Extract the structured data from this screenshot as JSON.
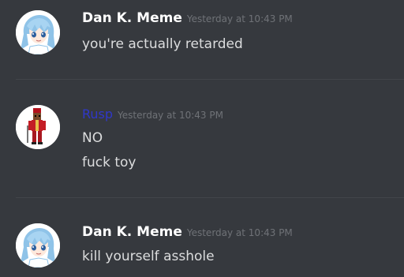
{
  "messages": [
    {
      "author": "Dan K. Meme",
      "timestamp": "Yesterday at 10:43 PM",
      "avatar": "anime-girl-avatar",
      "lines": [
        "you're actually retarded"
      ]
    },
    {
      "author": "Rusp",
      "timestamp": "Yesterday at 10:43 PM",
      "avatar": "red-uniform-character-avatar",
      "author_color": "#2f37c9",
      "lines": [
        "NO",
        "fuck toy"
      ]
    },
    {
      "author": "Dan K. Meme",
      "timestamp": "Yesterday at 10:43 PM",
      "avatar": "anime-girl-avatar",
      "lines": [
        "kill yourself asshole"
      ]
    }
  ],
  "colors": {
    "background": "#36393e",
    "username": "#ffffff",
    "timestamp": "#6f7277",
    "message_text": "#dcddde",
    "divider": "#42454a"
  }
}
